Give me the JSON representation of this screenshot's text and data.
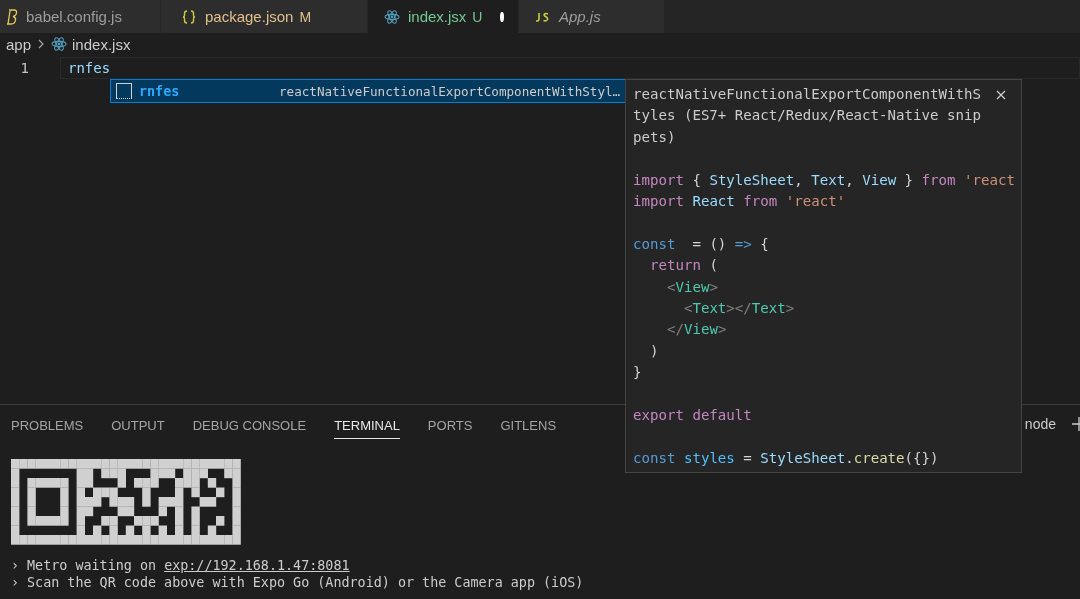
{
  "tabs": [
    {
      "label": "babel.config.js",
      "selected": false,
      "modified": false,
      "preview": false
    },
    {
      "label": "package.json",
      "status": "M",
      "selected": false,
      "modified": false,
      "preview": false
    },
    {
      "label": "index.jsx",
      "status": "U",
      "selected": true,
      "modified": true,
      "preview": false
    },
    {
      "label": "App.js",
      "selected": false,
      "modified": false,
      "preview": true
    }
  ],
  "breadcrumb": {
    "folder": "app",
    "file": "index.jsx"
  },
  "editor": {
    "lines": [
      {
        "number": "1",
        "text": "rnfes"
      }
    ]
  },
  "suggestions": [
    {
      "label": "rnfes",
      "detail": "reactNativeFunctionalExportComponentWithStyl…",
      "selected": true
    }
  ],
  "details": {
    "title": "reactNativeFunctionalExportComponentWithStyles (ES7+ React/Redux/React-Native snippets)",
    "code": [
      {
        "kind": "blank"
      },
      {
        "kind": "code",
        "tokens": [
          {
            "kind": "keyword",
            "text": "import"
          },
          {
            "kind": "plain",
            "text": " { "
          },
          {
            "kind": "variable",
            "text": "StyleSheet"
          },
          {
            "kind": "plain",
            "text": ", "
          },
          {
            "kind": "variable",
            "text": "Text"
          },
          {
            "kind": "plain",
            "text": ", "
          },
          {
            "kind": "variable",
            "text": "View"
          },
          {
            "kind": "plain",
            "text": " } "
          },
          {
            "kind": "keyword",
            "text": "from "
          },
          {
            "kind": "string",
            "text": "'react"
          }
        ]
      },
      {
        "kind": "code",
        "tokens": [
          {
            "kind": "keyword",
            "text": "import "
          },
          {
            "kind": "variable",
            "text": "React "
          },
          {
            "kind": "keyword",
            "text": "from "
          },
          {
            "kind": "string",
            "text": "'react'"
          }
        ]
      },
      {
        "kind": "blank"
      },
      {
        "kind": "code",
        "tokens": [
          {
            "kind": "storage",
            "text": "const"
          },
          {
            "kind": "plain",
            "text": "  = () "
          },
          {
            "kind": "storage",
            "text": "=>"
          },
          {
            "kind": "plain",
            "text": " {"
          }
        ]
      },
      {
        "kind": "code",
        "tokens": [
          {
            "kind": "keyword",
            "text": "  return"
          },
          {
            "kind": "plain",
            "text": " ("
          }
        ]
      },
      {
        "kind": "code",
        "tokens": [
          {
            "kind": "bracket",
            "text": "    <"
          },
          {
            "kind": "tag",
            "text": "View"
          },
          {
            "kind": "bracket",
            "text": ">"
          }
        ]
      },
      {
        "kind": "code",
        "tokens": [
          {
            "kind": "bracket",
            "text": "      <"
          },
          {
            "kind": "tag",
            "text": "Text"
          },
          {
            "kind": "bracket",
            "text": "></"
          },
          {
            "kind": "tag",
            "text": "Text"
          },
          {
            "kind": "bracket",
            "text": ">"
          }
        ]
      },
      {
        "kind": "code",
        "tokens": [
          {
            "kind": "bracket",
            "text": "    </"
          },
          {
            "kind": "tag",
            "text": "View"
          },
          {
            "kind": "bracket",
            "text": ">"
          }
        ]
      },
      {
        "kind": "code",
        "tokens": [
          {
            "kind": "plain",
            "text": "  )"
          }
        ]
      },
      {
        "kind": "code",
        "tokens": [
          {
            "kind": "plain",
            "text": "}"
          }
        ]
      },
      {
        "kind": "blank"
      },
      {
        "kind": "code",
        "tokens": [
          {
            "kind": "keyword",
            "text": "export default"
          }
        ]
      },
      {
        "kind": "blank"
      },
      {
        "kind": "code",
        "tokens": [
          {
            "kind": "storage",
            "text": "const "
          },
          {
            "kind": "constant",
            "text": "styles"
          },
          {
            "kind": "plain",
            "text": " = "
          },
          {
            "kind": "variable",
            "text": "StyleSheet"
          },
          {
            "kind": "plain",
            "text": "."
          },
          {
            "kind": "function",
            "text": "create"
          },
          {
            "kind": "plain",
            "text": "({})"
          }
        ]
      }
    ]
  },
  "panel": {
    "tabs": [
      {
        "label": "PROBLEMS",
        "selected": false
      },
      {
        "label": "OUTPUT",
        "selected": false
      },
      {
        "label": "DEBUG CONSOLE",
        "selected": false
      },
      {
        "label": "TERMINAL",
        "selected": true
      },
      {
        "label": "PORTS",
        "selected": false
      },
      {
        "label": "GITLENS",
        "selected": false
      }
    ],
    "terminal_name": "node",
    "terminal": [
      {
        "prompt": "›",
        "text": "Metro waiting on ",
        "link": "exp://192.168.1.47:8081"
      },
      {
        "prompt": "›",
        "text": "Scan the QR code above with Expo Go (Android) or the Camera app (iOS)"
      }
    ]
  }
}
